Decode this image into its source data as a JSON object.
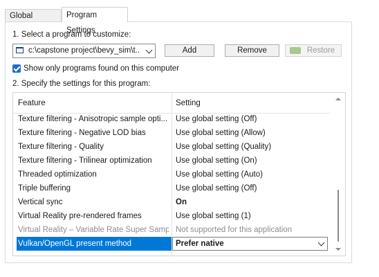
{
  "tabs": [
    {
      "label": "Global Settings",
      "active": false
    },
    {
      "label": "Program Settings",
      "active": true
    }
  ],
  "step1_label": "1. Select a program to customize:",
  "program_select": {
    "value": "c:\\capstone project\\bevy_sim\\t..."
  },
  "buttons": {
    "add": "Add",
    "remove": "Remove",
    "restore": "Restore"
  },
  "show_only_checkbox": {
    "label": "Show only programs found on this computer",
    "checked": true
  },
  "step2_label": "2. Specify the settings for this program:",
  "settings_table": {
    "columns": {
      "feature": "Feature",
      "setting": "Setting"
    },
    "rows": [
      {
        "feature": "Texture filtering - Anisotropic sample opti...",
        "setting": "Use global setting (Off)"
      },
      {
        "feature": "Texture filtering - Negative LOD bias",
        "setting": "Use global setting (Allow)"
      },
      {
        "feature": "Texture filtering - Quality",
        "setting": "Use global setting (Quality)"
      },
      {
        "feature": "Texture filtering - Trilinear optimization",
        "setting": "Use global setting (On)"
      },
      {
        "feature": "Threaded optimization",
        "setting": "Use global setting (Auto)"
      },
      {
        "feature": "Triple buffering",
        "setting": "Use global setting (Off)"
      },
      {
        "feature": "Vertical sync",
        "setting": "On"
      },
      {
        "feature": "Virtual Reality pre-rendered frames",
        "setting": "Use global setting (1)"
      },
      {
        "feature": "Virtual Reality – Variable Rate Super Samp...",
        "setting": "Not supported for this application"
      },
      {
        "feature": "Vulkan/OpenGL present method",
        "setting": "Prefer native"
      }
    ]
  },
  "colors": {
    "selection": "#0078d7",
    "checkbox": "#1f6fd0",
    "disabled_text": "#8d8d8d"
  }
}
